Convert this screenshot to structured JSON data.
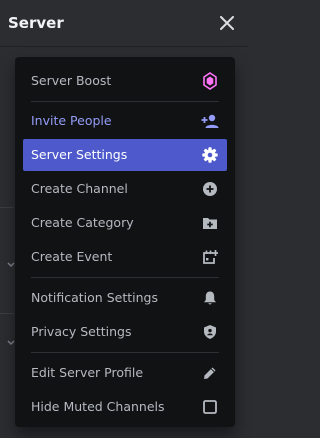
{
  "header": {
    "title": "Server"
  },
  "menu": {
    "items": [
      {
        "label": "Server Boost",
        "icon": "boost-icon"
      },
      {
        "label": "Invite People",
        "icon": "add-person-icon"
      },
      {
        "label": "Server Settings",
        "icon": "gear-icon"
      },
      {
        "label": "Create Channel",
        "icon": "plus-circle-icon"
      },
      {
        "label": "Create Category",
        "icon": "folder-plus-icon"
      },
      {
        "label": "Create Event",
        "icon": "calendar-plus-icon"
      },
      {
        "label": "Notification Settings",
        "icon": "bell-icon"
      },
      {
        "label": "Privacy Settings",
        "icon": "shield-icon"
      },
      {
        "label": "Edit Server Profile",
        "icon": "pencil-icon"
      },
      {
        "label": "Hide Muted Channels",
        "icon": "checkbox-icon"
      }
    ],
    "active_label": "Server Settings"
  },
  "colors": {
    "accent": "#5865f2",
    "invite_text": "#949cf7",
    "boost_pink": "#ff73fa",
    "menu_bg": "#111214",
    "panel_bg": "#2b2d31"
  }
}
